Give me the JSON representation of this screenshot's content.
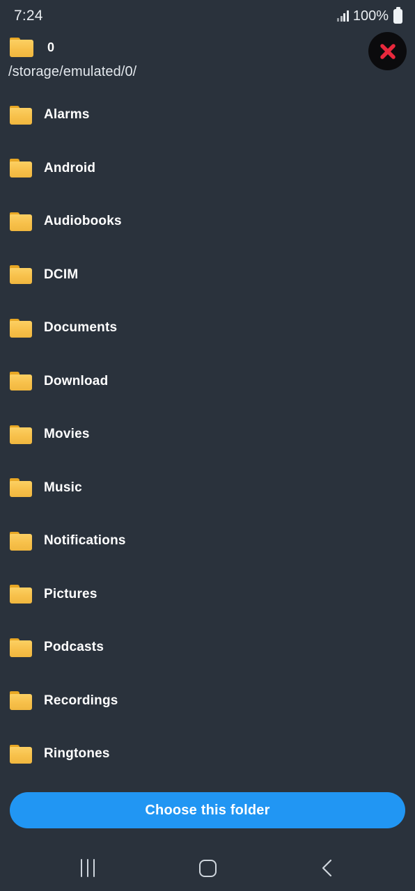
{
  "status_bar": {
    "time": "7:24",
    "battery_percent": "100%",
    "signal_icon": "signal-bars-icon",
    "battery_icon": "battery-full-icon"
  },
  "header": {
    "folder_icon": "folder-icon",
    "title": "0",
    "path": "/storage/emulated/0/",
    "close_icon": "close-x-icon",
    "close_label": "Close"
  },
  "colors": {
    "background": "#2a323c",
    "accent_blue": "#2196f3",
    "folder_yellow": "#f7c04a",
    "close_red": "#e8283c",
    "text_primary": "#ffffff"
  },
  "file_list": [
    {
      "name": "Alarms",
      "icon": "folder-icon"
    },
    {
      "name": "Android",
      "icon": "folder-icon"
    },
    {
      "name": "Audiobooks",
      "icon": "folder-icon"
    },
    {
      "name": "DCIM",
      "icon": "folder-icon"
    },
    {
      "name": "Documents",
      "icon": "folder-icon"
    },
    {
      "name": "Download",
      "icon": "folder-icon"
    },
    {
      "name": "Movies",
      "icon": "folder-icon"
    },
    {
      "name": "Music",
      "icon": "folder-icon"
    },
    {
      "name": "Notifications",
      "icon": "folder-icon"
    },
    {
      "name": "Pictures",
      "icon": "folder-icon"
    },
    {
      "name": "Podcasts",
      "icon": "folder-icon"
    },
    {
      "name": "Recordings",
      "icon": "folder-icon"
    },
    {
      "name": "Ringtones",
      "icon": "folder-icon"
    }
  ],
  "footer": {
    "choose_label": "Choose this folder"
  },
  "nav_bar": {
    "recents_icon": "recents-icon",
    "home_icon": "home-icon",
    "back_icon": "back-chevron-icon"
  }
}
